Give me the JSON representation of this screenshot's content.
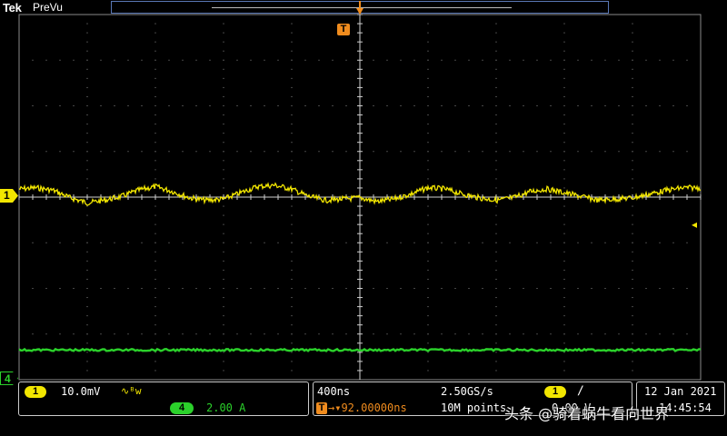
{
  "header": {
    "brand": "Tek",
    "acquisition_state": "PreVu"
  },
  "markers": {
    "ch1_label": "1",
    "ch4_label": "4",
    "trigger_label": "T",
    "trigger_level_arrow": "◂"
  },
  "vertical_readout": {
    "ch1_badge": "1",
    "ch1_scale": "10.0mV",
    "ch1_bandwidth": "∿ᴮw",
    "ch4_badge": "4",
    "ch4_scale": "2.00 A"
  },
  "horizontal_readout": {
    "time_per_div": "400ns",
    "sample_rate": "2.50GS/s",
    "trigger_badge": "T",
    "trigger_delay": "→▾92.00000ns",
    "record_length": "10M points",
    "trigger_source_badge": "1",
    "trigger_slope": "∕",
    "trigger_level": "0.00 V"
  },
  "datetime": {
    "date": "12 Jan  2021",
    "time": "14:45:54"
  },
  "watermark": "头条 @骑着蜗牛看向世界",
  "colors": {
    "ch1": "#f2e600",
    "ch4": "#2bd12b",
    "trigger": "#f08c1e",
    "graticule": "#8a8a8a"
  },
  "chart_data": {
    "type": "line",
    "series": [
      {
        "channel": "1",
        "unit": "div",
        "description_values_x_div": [
          0,
          0.25,
          0.5,
          0.75,
          1,
          1.25,
          1.5,
          1.75,
          2,
          2.25,
          2.5,
          2.75,
          3,
          3.25,
          3.5,
          3.75,
          4,
          4.25,
          4.5,
          4.75,
          5,
          5.25,
          5.5,
          5.75,
          6,
          6.25,
          6.5,
          6.75,
          7,
          7.25,
          7.5,
          7.75,
          8,
          8.25,
          8.5,
          8.75,
          9,
          9.25,
          9.5,
          9.75,
          10
        ],
        "values_y_div": [
          0.25,
          0.3,
          0.2,
          -0.1,
          -0.3,
          -0.2,
          -0.05,
          0.2,
          0.35,
          0.15,
          -0.1,
          -0.2,
          -0.15,
          0.1,
          0.35,
          0.4,
          0.25,
          -0.05,
          -0.2,
          -0.15,
          -0.1,
          -0.25,
          -0.15,
          0.05,
          0.3,
          0.25,
          0.05,
          -0.1,
          -0.2,
          -0.1,
          0.15,
          0.25,
          0.1,
          -0.05,
          -0.2,
          -0.15,
          -0.1,
          0.05,
          0.2,
          0.3,
          0.3
        ]
      },
      {
        "channel": "4",
        "unit": "div",
        "values_y_div": [
          -3.35
        ]
      }
    ]
  }
}
